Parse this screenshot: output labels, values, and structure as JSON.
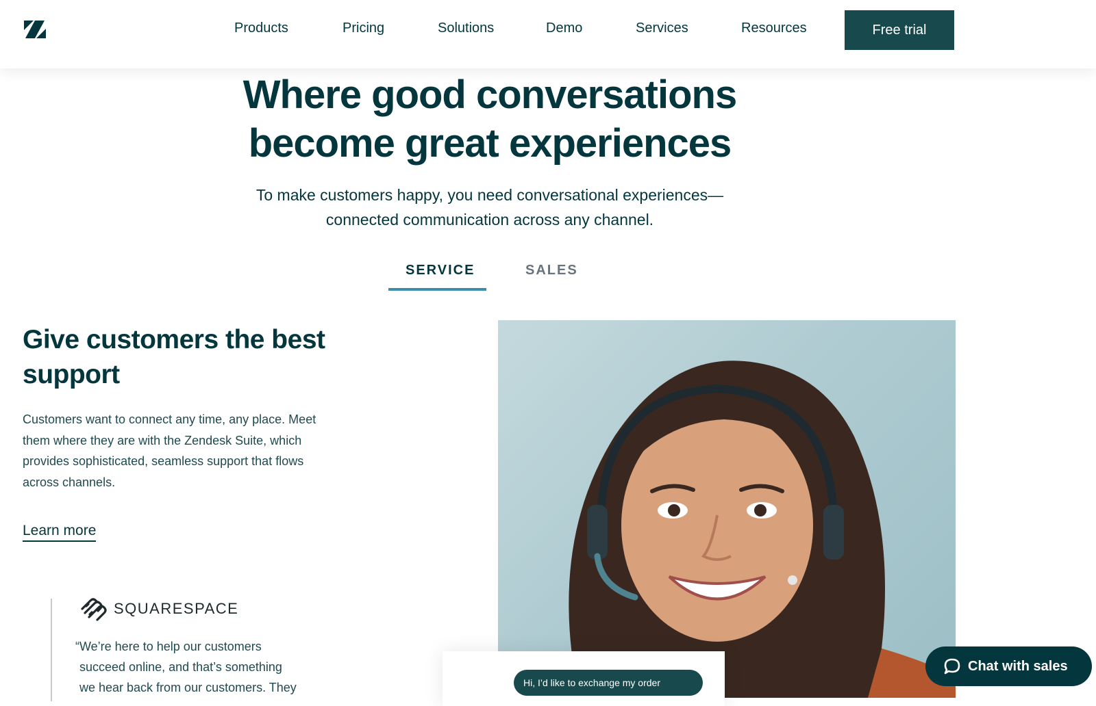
{
  "header": {
    "logo": "zendesk-logo",
    "nav": [
      "Products",
      "Pricing",
      "Solutions",
      "Demo",
      "Services",
      "Resources"
    ],
    "cta_label": "Free trial"
  },
  "hero": {
    "title_lines": [
      "Where good conversations",
      "become great experiences"
    ],
    "subtitle_lines": [
      "To make customers happy, you need conversational experiences—",
      "connected communication across any channel."
    ]
  },
  "tabs": [
    {
      "label": "SERVICE",
      "active": true
    },
    {
      "label": "SALES",
      "active": false
    }
  ],
  "section": {
    "title": "Give customers the best support",
    "body": "Customers want to connect any time, any place. Meet them where they are with the Zendesk Suite, which provides sophisticated, seamless support that flows across channels.",
    "link": "Learn more"
  },
  "testimonial": {
    "brand": "SQUARESPACE",
    "quote_lines": [
      "“We’re here to help our customers",
      "succeed online, and that’s something",
      "we hear back from our customers. They"
    ]
  },
  "photo": {
    "chat_message": "Hi, I’d like to exchange my order"
  },
  "chat_widget": {
    "label": "Chat with sales",
    "icon": "chat-bubble-icon"
  },
  "colors": {
    "brand_dark": "#03363d",
    "button": "#17494d",
    "tab_accent": "#3b8eab",
    "inactive_tab": "#68737d"
  }
}
